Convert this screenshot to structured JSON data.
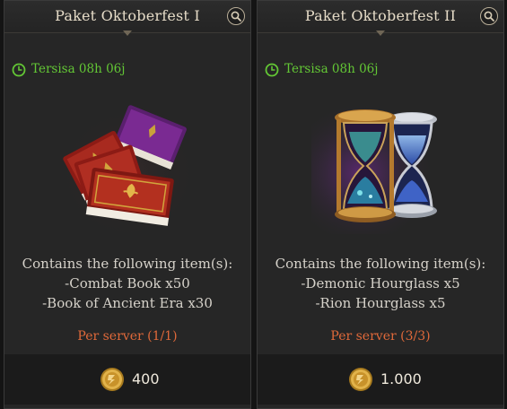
{
  "packages": [
    {
      "title": "Paket Oktoberfest I",
      "timer": "Tersisa 08h 06j",
      "contents_heading": "Contains the following item(s):",
      "items": [
        "-Combat Book x50",
        "-Book of Ancient Era x30"
      ],
      "limit": "Per server (1/1)",
      "price": "400",
      "image": "stack-of-books-icon"
    },
    {
      "title": "Paket Oktoberfest II",
      "timer": "Tersisa 08h 06j",
      "contents_heading": "Contains the following item(s):",
      "items": [
        "-Demonic Hourglass x5",
        "-Rion Hourglass x5"
      ],
      "limit": "Per server (3/3)",
      "price": "1.000",
      "image": "hourglasses-icon"
    }
  ],
  "icons": {
    "search": "magnifier-icon",
    "timer": "clock-icon",
    "currency": "gold-coin-icon"
  },
  "colors": {
    "timer_text": "#63c735",
    "limit_text": "#e0693a",
    "card_bg": "#262626",
    "price_bar_bg": "#1b1b1b"
  }
}
